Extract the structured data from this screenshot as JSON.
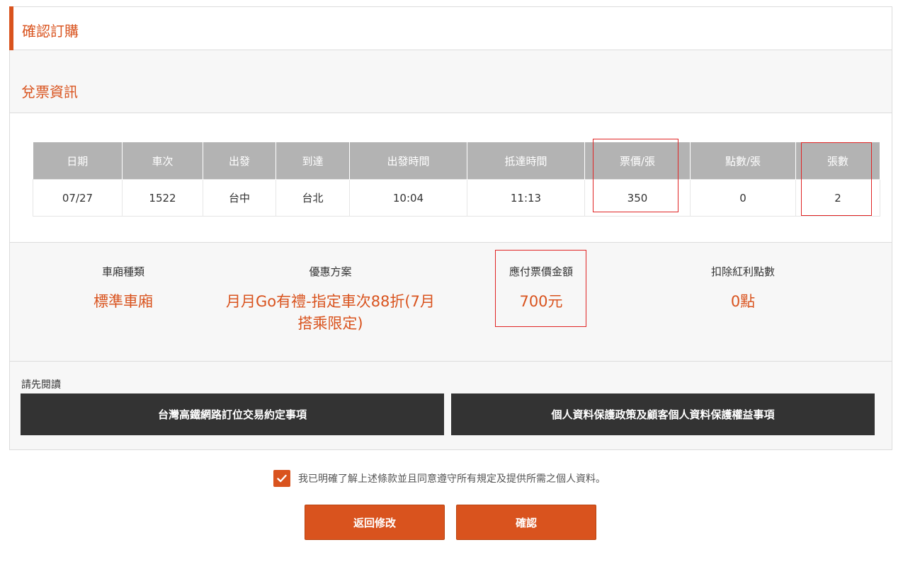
{
  "header": {
    "title": "確認訂購"
  },
  "ticket_info": {
    "title": "兌票資訊"
  },
  "table": {
    "headers": [
      "日期",
      "車次",
      "出發",
      "到達",
      "出發時間",
      "抵達時間",
      "票價/張",
      "點數/張",
      "張數"
    ],
    "row": [
      "07/27",
      "1522",
      "台中",
      "台北",
      "10:04",
      "11:13",
      "350",
      "0",
      "2"
    ]
  },
  "summary": {
    "car_type_label": "車廂種類",
    "car_type_value": "標準車廂",
    "promo_label": "優惠方案",
    "promo_value": "月月Go有禮-指定車次88折(7月搭乘限定)",
    "amount_label": "應付票價金額",
    "amount_value": "700元",
    "points_label": "扣除紅利點數",
    "points_value": "0點"
  },
  "read_first": {
    "label": "請先閱讀",
    "terms_button": "台灣高鐵網路訂位交易約定事項",
    "privacy_button": "個人資料保護政策及顧客個人資料保護權益事項"
  },
  "agreement": {
    "checked": true,
    "text": "我已明確了解上述條款並且同意遵守所有規定及提供所需之個人資料。"
  },
  "buttons": {
    "back": "返回修改",
    "confirm": "確認"
  },
  "colors": {
    "accent": "#d9531e",
    "header_gray": "#b3b3b3",
    "dark_button": "#333333",
    "highlight_box": "#e02424"
  }
}
